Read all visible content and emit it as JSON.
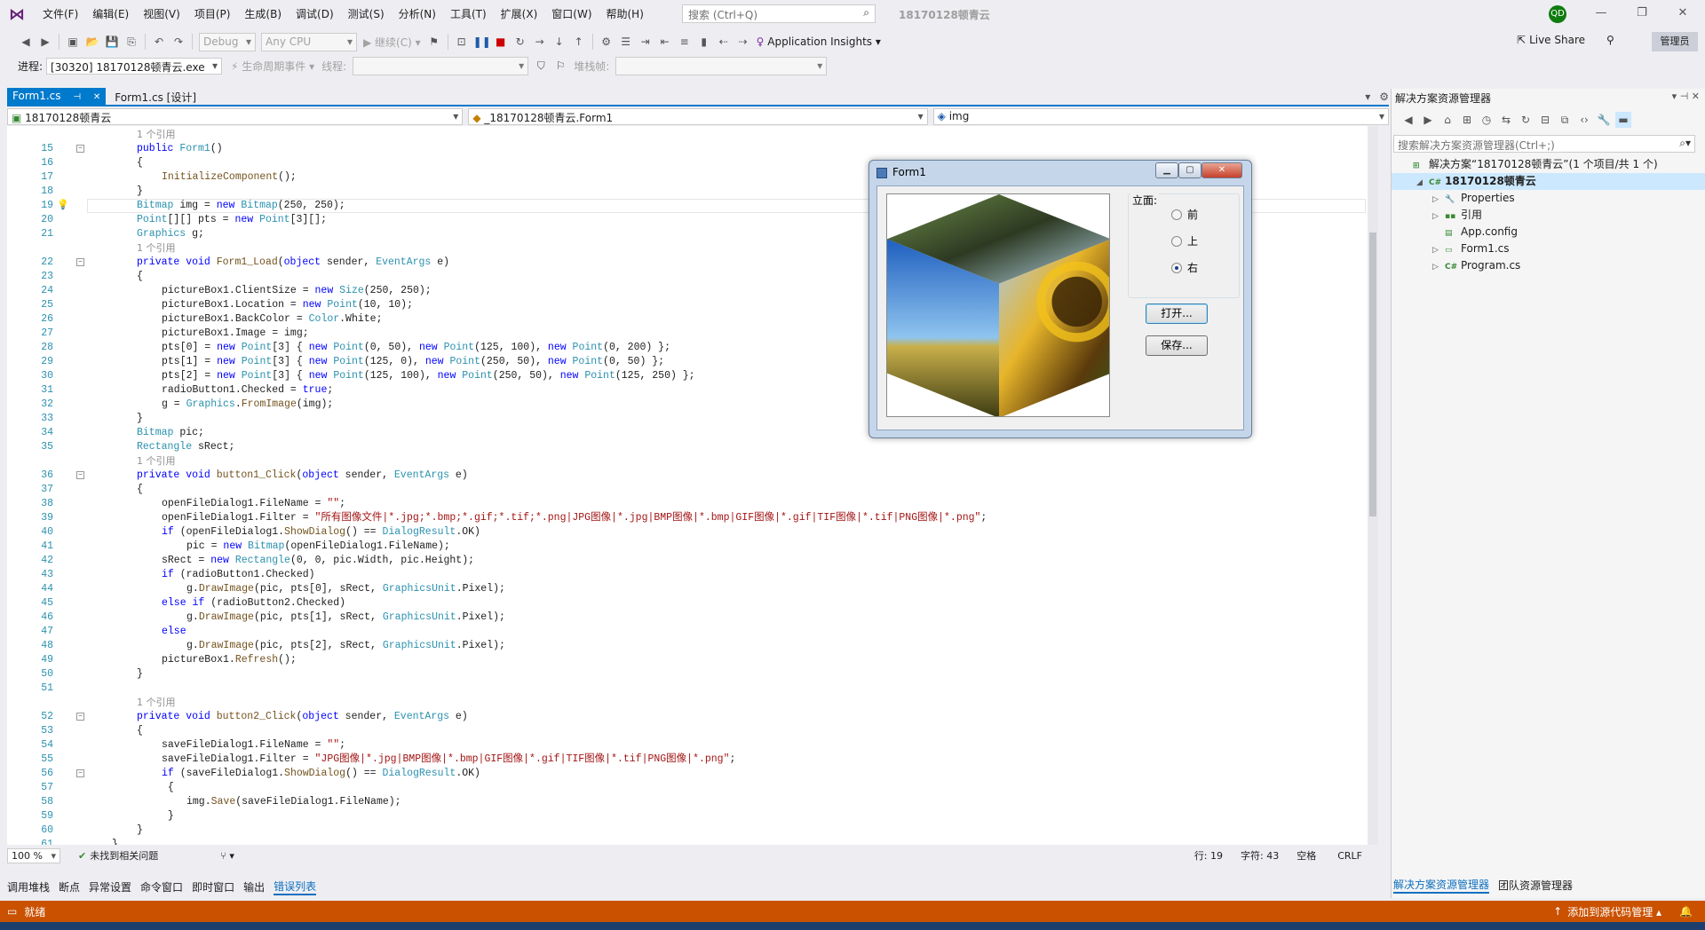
{
  "menu": [
    "文件(F)",
    "编辑(E)",
    "视图(V)",
    "项目(P)",
    "生成(B)",
    "调试(D)",
    "测试(S)",
    "分析(N)",
    "工具(T)",
    "扩展(X)",
    "窗口(W)",
    "帮助(H)"
  ],
  "search": {
    "placeholder": "搜索 (Ctrl+Q)"
  },
  "project_name": "18170128顿青云",
  "avatar_initials": "QD",
  "toolbar": {
    "config": "Debug",
    "platform": "Any CPU",
    "continue": "继续(C)",
    "app_insights": "Application Insights",
    "live_share": "Live Share",
    "admin": "管理员"
  },
  "debugbar": {
    "process_label": "进程:",
    "process_value": "[30320] 18170128顿青云.exe",
    "lifecycle": "生命周期事件",
    "thread_label": "线程:",
    "stackframe_label": "堆栈帧:"
  },
  "tabs": [
    {
      "label": "Form1.cs",
      "active": true
    },
    {
      "label": "Form1.cs [设计]",
      "active": false
    }
  ],
  "nav": {
    "project": "18170128顿青云",
    "class": "_18170128顿青云.Form1",
    "member": "img"
  },
  "code_lines": [
    {
      "n": "",
      "ref": "1 个引用",
      "indent": 0
    },
    {
      "n": "15",
      "html": "<span class='k'>public</span> <span class='t'>Form1</span>()",
      "indent": 0,
      "fold": true
    },
    {
      "n": "16",
      "html": "{",
      "indent": 0
    },
    {
      "n": "17",
      "html": "<span class='m'>InitializeComponent</span>();",
      "indent": 1
    },
    {
      "n": "18",
      "html": "}",
      "indent": 0
    },
    {
      "n": "19",
      "html": "<span class='t'>Bitmap</span> img = <span class='k'>new</span> <span class='t'>Bitmap</span>(250, 250);",
      "indent": 0,
      "current": true
    },
    {
      "n": "20",
      "html": "<span class='t'>Point</span>[][] pts = <span class='k'>new</span> <span class='t'>Point</span>[3][];",
      "indent": 0
    },
    {
      "n": "21",
      "html": "<span class='t'>Graphics</span> g;",
      "indent": 0
    },
    {
      "n": "",
      "ref": "1 个引用",
      "indent": 0
    },
    {
      "n": "22",
      "html": "<span class='k'>private</span> <span class='k'>void</span> <span class='m'>Form1_Load</span>(<span class='k'>object</span> sender, <span class='t'>EventArgs</span> e)",
      "indent": 0,
      "fold": true
    },
    {
      "n": "23",
      "html": "{",
      "indent": 0
    },
    {
      "n": "24",
      "html": "pictureBox1.ClientSize = <span class='k'>new</span> <span class='t'>Size</span>(250, 250);",
      "indent": 1
    },
    {
      "n": "25",
      "html": "pictureBox1.Location = <span class='k'>new</span> <span class='t'>Point</span>(10, 10);",
      "indent": 1
    },
    {
      "n": "26",
      "html": "pictureBox1.BackColor = <span class='t'>Color</span>.White;",
      "indent": 1
    },
    {
      "n": "27",
      "html": "pictureBox1.Image = img;",
      "indent": 1
    },
    {
      "n": "28",
      "html": "pts[0] = <span class='k'>new</span> <span class='t'>Point</span>[3] { <span class='k'>new</span> <span class='t'>Point</span>(0, 50), <span class='k'>new</span> <span class='t'>Point</span>(125, 100), <span class='k'>new</span> <span class='t'>Point</span>(0, 200) };",
      "indent": 1
    },
    {
      "n": "29",
      "html": "pts[1] = <span class='k'>new</span> <span class='t'>Point</span>[3] { <span class='k'>new</span> <span class='t'>Point</span>(125, 0), <span class='k'>new</span> <span class='t'>Point</span>(250, 50), <span class='k'>new</span> <span class='t'>Point</span>(0, 50) };",
      "indent": 1
    },
    {
      "n": "30",
      "html": "pts[2] = <span class='k'>new</span> <span class='t'>Point</span>[3] { <span class='k'>new</span> <span class='t'>Point</span>(125, 100), <span class='k'>new</span> <span class='t'>Point</span>(250, 50), <span class='k'>new</span> <span class='t'>Point</span>(125, 250) };",
      "indent": 1
    },
    {
      "n": "31",
      "html": "radioButton1.Checked = <span class='k'>true</span>;",
      "indent": 1
    },
    {
      "n": "32",
      "html": "g = <span class='t'>Graphics</span>.<span class='m'>FromImage</span>(img);",
      "indent": 1
    },
    {
      "n": "33",
      "html": "}",
      "indent": 0
    },
    {
      "n": "34",
      "html": "<span class='t'>Bitmap</span> pic;",
      "indent": 0
    },
    {
      "n": "35",
      "html": "<span class='t'>Rectangle</span> sRect;",
      "indent": 0
    },
    {
      "n": "",
      "ref": "1 个引用",
      "indent": 0
    },
    {
      "n": "36",
      "html": "<span class='k'>private</span> <span class='k'>void</span> <span class='m'>button1_Click</span>(<span class='k'>object</span> sender, <span class='t'>EventArgs</span> e)",
      "indent": 0,
      "fold": true
    },
    {
      "n": "37",
      "html": "{",
      "indent": 0
    },
    {
      "n": "38",
      "html": "openFileDialog1.FileName = <span class='s'>\"\"</span>;",
      "indent": 1
    },
    {
      "n": "39",
      "html": "openFileDialog1.Filter = <span class='s'>\"所有图像文件|*.jpg;*.bmp;*.gif;*.tif;*.png|JPG图像|*.jpg|BMP图像|*.bmp|GIF图像|*.gif|TIF图像|*.tif|PNG图像|*.png\"</span>;",
      "indent": 1
    },
    {
      "n": "40",
      "html": "<span class='k'>if</span> (openFileDialog1.<span class='m'>ShowDialog</span>() == <span class='t'>DialogResult</span>.OK)",
      "indent": 1
    },
    {
      "n": "41",
      "html": "pic = <span class='k'>new</span> <span class='t'>Bitmap</span>(openFileDialog1.FileName);",
      "indent": 2
    },
    {
      "n": "42",
      "html": "sRect = <span class='k'>new</span> <span class='t'>Rectangle</span>(0, 0, pic.Width, pic.Height);",
      "indent": 1
    },
    {
      "n": "43",
      "html": "<span class='k'>if</span> (radioButton1.Checked)",
      "indent": 1
    },
    {
      "n": "44",
      "html": "g.<span class='m'>DrawImage</span>(pic, pts[0], sRect, <span class='t'>GraphicsUnit</span>.Pixel);",
      "indent": 2
    },
    {
      "n": "45",
      "html": "<span class='k'>else if</span> (radioButton2.Checked)",
      "indent": 1
    },
    {
      "n": "46",
      "html": "g.<span class='m'>DrawImage</span>(pic, pts[1], sRect, <span class='t'>GraphicsUnit</span>.Pixel);",
      "indent": 2
    },
    {
      "n": "47",
      "html": "<span class='k'>else</span>",
      "indent": 1
    },
    {
      "n": "48",
      "html": "g.<span class='m'>DrawImage</span>(pic, pts[2], sRect, <span class='t'>GraphicsUnit</span>.Pixel);",
      "indent": 2
    },
    {
      "n": "49",
      "html": "pictureBox1.<span class='m'>Refresh</span>();",
      "indent": 1
    },
    {
      "n": "50",
      "html": "}",
      "indent": 0
    },
    {
      "n": "51",
      "html": "",
      "indent": 0
    },
    {
      "n": "",
      "ref": "1 个引用",
      "indent": 0
    },
    {
      "n": "52",
      "html": "<span class='k'>private</span> <span class='k'>void</span> <span class='m'>button2_Click</span>(<span class='k'>object</span> sender, <span class='t'>EventArgs</span> e)",
      "indent": 0,
      "fold": true
    },
    {
      "n": "53",
      "html": "{",
      "indent": 0
    },
    {
      "n": "54",
      "html": "saveFileDialog1.FileName = <span class='s'>\"\"</span>;",
      "indent": 1
    },
    {
      "n": "55",
      "html": "saveFileDialog1.Filter = <span class='s'>\"JPG图像|*.jpg|BMP图像|*.bmp|GIF图像|*.gif|TIF图像|*.tif|PNG图像|*.png\"</span>;",
      "indent": 1
    },
    {
      "n": "56",
      "html": "<span class='k'>if</span> (saveFileDialog1.<span class='m'>ShowDialog</span>() == <span class='t'>DialogResult</span>.OK)",
      "indent": 1,
      "fold": true
    },
    {
      "n": "57",
      "html": " {",
      "indent": 1
    },
    {
      "n": "58",
      "html": "img.<span class='m'>Save</span>(saveFileDialog1.FileName);",
      "indent": 2
    },
    {
      "n": "59",
      "html": " }",
      "indent": 1
    },
    {
      "n": "60",
      "html": "}",
      "indent": 0
    },
    {
      "n": "61",
      "html": "}",
      "indent": -1
    }
  ],
  "editor_status": {
    "zoom": "100 %",
    "issues": "未找到相关问题",
    "row": "行: 19",
    "col": "字符: 43",
    "space": "空格",
    "eol": "CRLF"
  },
  "bottom_tabs": [
    "调用堆栈",
    "断点",
    "异常设置",
    "命令窗口",
    "即时窗口",
    "输出",
    "错误列表"
  ],
  "bottom_tabs_active": "错误列表",
  "solution_explorer": {
    "title": "解决方案资源管理器",
    "search_placeholder": "搜索解决方案资源管理器(Ctrl+;)",
    "nodes": [
      {
        "label": "解决方案“18170128顿青云”(1 个项目/共 1 个)",
        "level": 0,
        "icon": "solution-icon",
        "expander": ""
      },
      {
        "label": "18170128顿青云",
        "level": 1,
        "icon": "csharp-project-icon",
        "expander": "◢",
        "selected": true,
        "bold": true
      },
      {
        "label": "Properties",
        "level": 2,
        "icon": "wrench-icon",
        "expander": "▷"
      },
      {
        "label": "引用",
        "level": 2,
        "icon": "references-icon",
        "expander": "▷"
      },
      {
        "label": "App.config",
        "level": 2,
        "icon": "config-file-icon",
        "expander": ""
      },
      {
        "label": "Form1.cs",
        "level": 2,
        "icon": "form-file-icon",
        "expander": "▷"
      },
      {
        "label": "Program.cs",
        "level": 2,
        "icon": "csharp-file-icon",
        "expander": "▷"
      }
    ],
    "bottom_tabs": [
      "解决方案资源管理器",
      "团队资源管理器"
    ]
  },
  "statusbar": {
    "left": "就绪",
    "right": "添加到源代码管理"
  },
  "form1": {
    "title": "Form1",
    "group_label": "立面:",
    "radios": [
      {
        "label": "前",
        "checked": false
      },
      {
        "label": "上",
        "checked": false
      },
      {
        "label": "右",
        "checked": true
      }
    ],
    "open_button": "打开...",
    "save_button": "保存..."
  },
  "colors": {
    "accent": "#007acc",
    "statusbar": "#ca5100",
    "keyword": "#0000ff",
    "type": "#2b91af",
    "string": "#a31515"
  }
}
